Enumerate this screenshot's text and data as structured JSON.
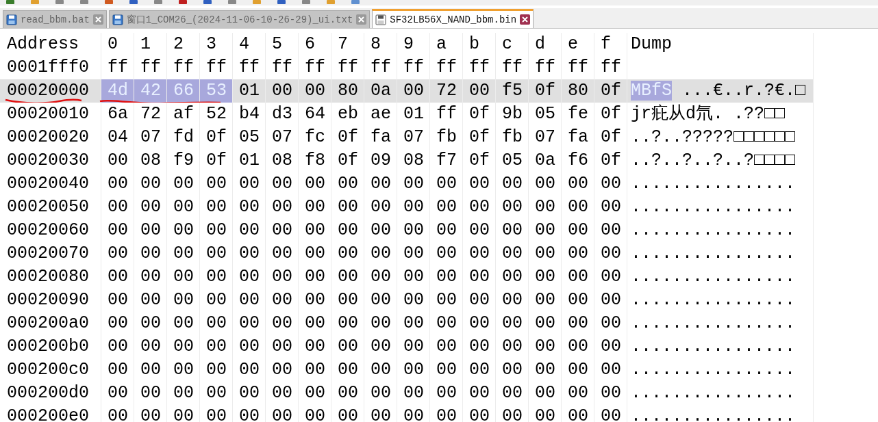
{
  "tabs": [
    {
      "label": "read_bbm.bat",
      "selected": false
    },
    {
      "label": "窗口1_COM26_(2024-11-06-10-26-29)_ui.txt",
      "selected": false
    },
    {
      "label": "SF32LB56X_NAND_bbm.bin",
      "selected": true
    }
  ],
  "table": {
    "columns": [
      "Address",
      "0",
      "1",
      "2",
      "3",
      "4",
      "5",
      "6",
      "7",
      "8",
      "9",
      "a",
      "b",
      "c",
      "d",
      "e",
      "f",
      "Dump"
    ],
    "rows": [
      {
        "address": "0001fff0",
        "selected": false,
        "underlined": false,
        "bytes": [
          "ff",
          "ff",
          "ff",
          "ff",
          "ff",
          "ff",
          "ff",
          "ff",
          "ff",
          "ff",
          "ff",
          "ff",
          "ff",
          "ff",
          "ff",
          "ff"
        ]
      },
      {
        "address": "00020000",
        "selected": true,
        "underlined": true,
        "selection": {
          "bytes": [
            "4d",
            "42",
            "66",
            "53"
          ],
          "dump": "MBfS"
        },
        "bytes": [
          "01",
          "00",
          "00",
          "80",
          "0a",
          "00",
          "72",
          "00",
          "f5",
          "0f",
          "80",
          "0f"
        ],
        "dump": "...€..r.?€.□"
      },
      {
        "address": "00020010",
        "selected": false,
        "underlined": false,
        "bytes": [
          "6a",
          "72",
          "af",
          "52",
          "b4",
          "d3",
          "64",
          "eb",
          "ae",
          "01",
          "ff",
          "0f",
          "9b",
          "05",
          "fe",
          "0f"
        ],
        "dump": "jr疪从d氘.  .??□□"
      },
      {
        "address": "00020020",
        "selected": false,
        "underlined": false,
        "bytes": [
          "04",
          "07",
          "fd",
          "0f",
          "05",
          "07",
          "fc",
          "0f",
          "fa",
          "07",
          "fb",
          "0f",
          "fb",
          "07",
          "fa",
          "0f"
        ],
        "dump": "..?..?????□□□□□□"
      },
      {
        "address": "00020030",
        "selected": false,
        "underlined": false,
        "bytes": [
          "00",
          "08",
          "f9",
          "0f",
          "01",
          "08",
          "f8",
          "0f",
          "09",
          "08",
          "f7",
          "0f",
          "05",
          "0a",
          "f6",
          "0f"
        ],
        "dump": "..?..?..?..?□□□□"
      },
      {
        "address": "00020040",
        "selected": false,
        "underlined": false,
        "bytes": [
          "00",
          "00",
          "00",
          "00",
          "00",
          "00",
          "00",
          "00",
          "00",
          "00",
          "00",
          "00",
          "00",
          "00",
          "00",
          "00"
        ],
        "dump": "................"
      },
      {
        "address": "00020050",
        "selected": false,
        "underlined": false,
        "bytes": [
          "00",
          "00",
          "00",
          "00",
          "00",
          "00",
          "00",
          "00",
          "00",
          "00",
          "00",
          "00",
          "00",
          "00",
          "00",
          "00"
        ],
        "dump": "................"
      },
      {
        "address": "00020060",
        "selected": false,
        "underlined": false,
        "bytes": [
          "00",
          "00",
          "00",
          "00",
          "00",
          "00",
          "00",
          "00",
          "00",
          "00",
          "00",
          "00",
          "00",
          "00",
          "00",
          "00"
        ],
        "dump": "................"
      },
      {
        "address": "00020070",
        "selected": false,
        "underlined": false,
        "bytes": [
          "00",
          "00",
          "00",
          "00",
          "00",
          "00",
          "00",
          "00",
          "00",
          "00",
          "00",
          "00",
          "00",
          "00",
          "00",
          "00"
        ],
        "dump": "................"
      },
      {
        "address": "00020080",
        "selected": false,
        "underlined": false,
        "bytes": [
          "00",
          "00",
          "00",
          "00",
          "00",
          "00",
          "00",
          "00",
          "00",
          "00",
          "00",
          "00",
          "00",
          "00",
          "00",
          "00"
        ],
        "dump": "................"
      },
      {
        "address": "00020090",
        "selected": false,
        "underlined": false,
        "bytes": [
          "00",
          "00",
          "00",
          "00",
          "00",
          "00",
          "00",
          "00",
          "00",
          "00",
          "00",
          "00",
          "00",
          "00",
          "00",
          "00"
        ],
        "dump": "................"
      },
      {
        "address": "000200a0",
        "selected": false,
        "underlined": false,
        "bytes": [
          "00",
          "00",
          "00",
          "00",
          "00",
          "00",
          "00",
          "00",
          "00",
          "00",
          "00",
          "00",
          "00",
          "00",
          "00",
          "00"
        ],
        "dump": "................"
      },
      {
        "address": "000200b0",
        "selected": false,
        "underlined": false,
        "bytes": [
          "00",
          "00",
          "00",
          "00",
          "00",
          "00",
          "00",
          "00",
          "00",
          "00",
          "00",
          "00",
          "00",
          "00",
          "00",
          "00"
        ],
        "dump": "................"
      },
      {
        "address": "000200c0",
        "selected": false,
        "underlined": false,
        "bytes": [
          "00",
          "00",
          "00",
          "00",
          "00",
          "00",
          "00",
          "00",
          "00",
          "00",
          "00",
          "00",
          "00",
          "00",
          "00",
          "00"
        ],
        "dump": "................"
      },
      {
        "address": "000200d0",
        "selected": false,
        "underlined": false,
        "bytes": [
          "00",
          "00",
          "00",
          "00",
          "00",
          "00",
          "00",
          "00",
          "00",
          "00",
          "00",
          "00",
          "00",
          "00",
          "00",
          "00"
        ],
        "dump": "................"
      },
      {
        "address": "000200e0",
        "selected": false,
        "bytes": [
          "00",
          "00",
          "00",
          "00",
          "00",
          "00",
          "00",
          "00",
          "00",
          "00",
          "00",
          "00",
          "00",
          "00",
          "00",
          "00"
        ],
        "dump": "................"
      }
    ]
  }
}
